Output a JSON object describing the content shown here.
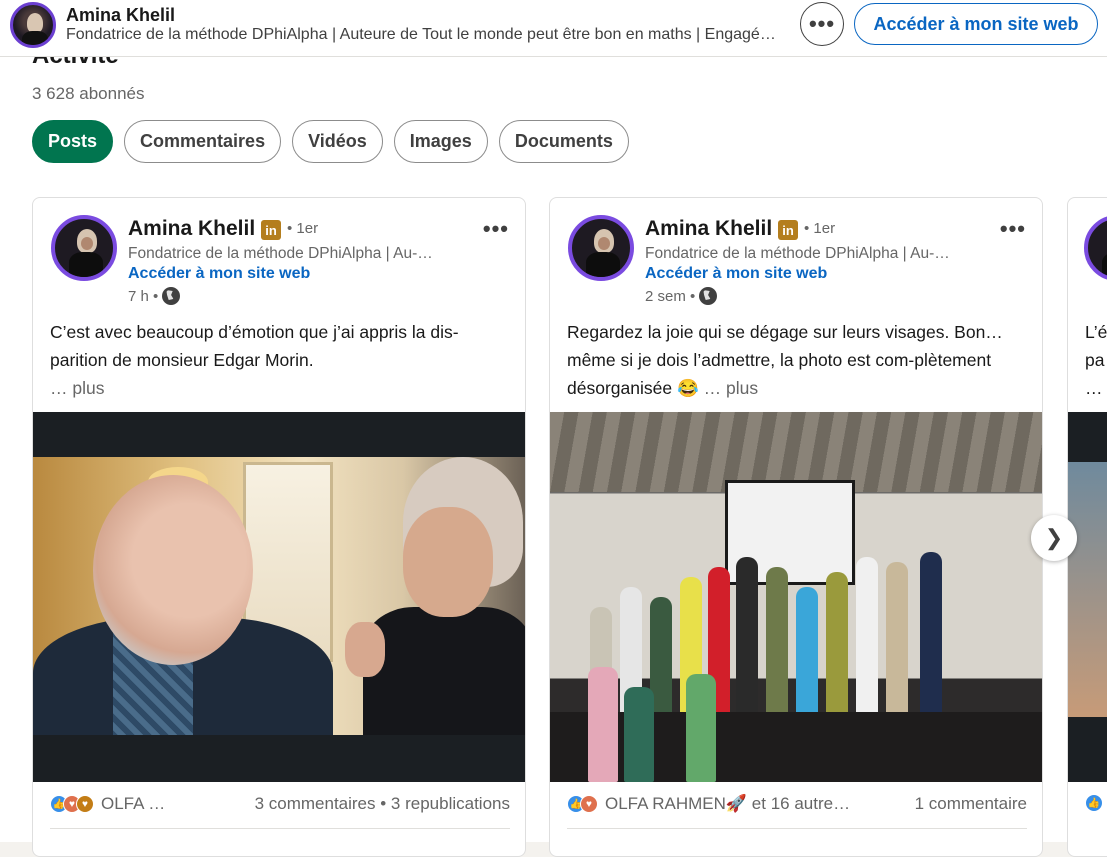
{
  "header": {
    "name": "Amina Khelil",
    "headline": "Fondatrice de la méthode DPhiAlpha | Auteure de Tout le monde peut être bon en maths | Engagé…",
    "more_label": "•••",
    "site_button": "Accéder à mon site web"
  },
  "activity": {
    "title": "Activité",
    "followers": "3 628 abonnés",
    "filters": [
      "Posts",
      "Commentaires",
      "Vidéos",
      "Images",
      "Documents"
    ],
    "active_filter": "Posts"
  },
  "posts": [
    {
      "author": "Amina Khelil",
      "badge": "in",
      "degree": "• 1er",
      "headline": "Fondatrice de la méthode DPhiAlpha | Au-…",
      "site_link": "Accéder à mon site web",
      "time": "7 h •",
      "text": "C’est avec beaucoup d’émotion que j’ai appris la dis-parition de monsieur Edgar Morin.",
      "more": "… plus",
      "reactions_who": "OLFA …",
      "stats": "3 commentaires • 3 republications"
    },
    {
      "author": "Amina Khelil",
      "badge": "in",
      "degree": "• 1er",
      "headline": "Fondatrice de la méthode DPhiAlpha | Au-…",
      "site_link": "Accéder à mon site web",
      "time": "2 sem •",
      "text": "Regardez la joie qui se dégage sur leurs visages. Bon… même si je dois l’admettre, la photo est com-plètement désorganisée 😂",
      "more": "… plus",
      "reactions_who": "OLFA RAHMEN🚀   et 16 autre…",
      "stats": "1 commentaire"
    }
  ],
  "partial_post": {
    "text_line1": "L’é",
    "text_line2": "pa",
    "text_line3": "…"
  },
  "icons": {
    "next": "chevron-right-icon",
    "globe": "globe-icon",
    "more": "ellipsis-icon"
  },
  "colors": {
    "accent": "#0a66c2",
    "active_pill": "#01754f",
    "badge": "#b47e1e"
  }
}
